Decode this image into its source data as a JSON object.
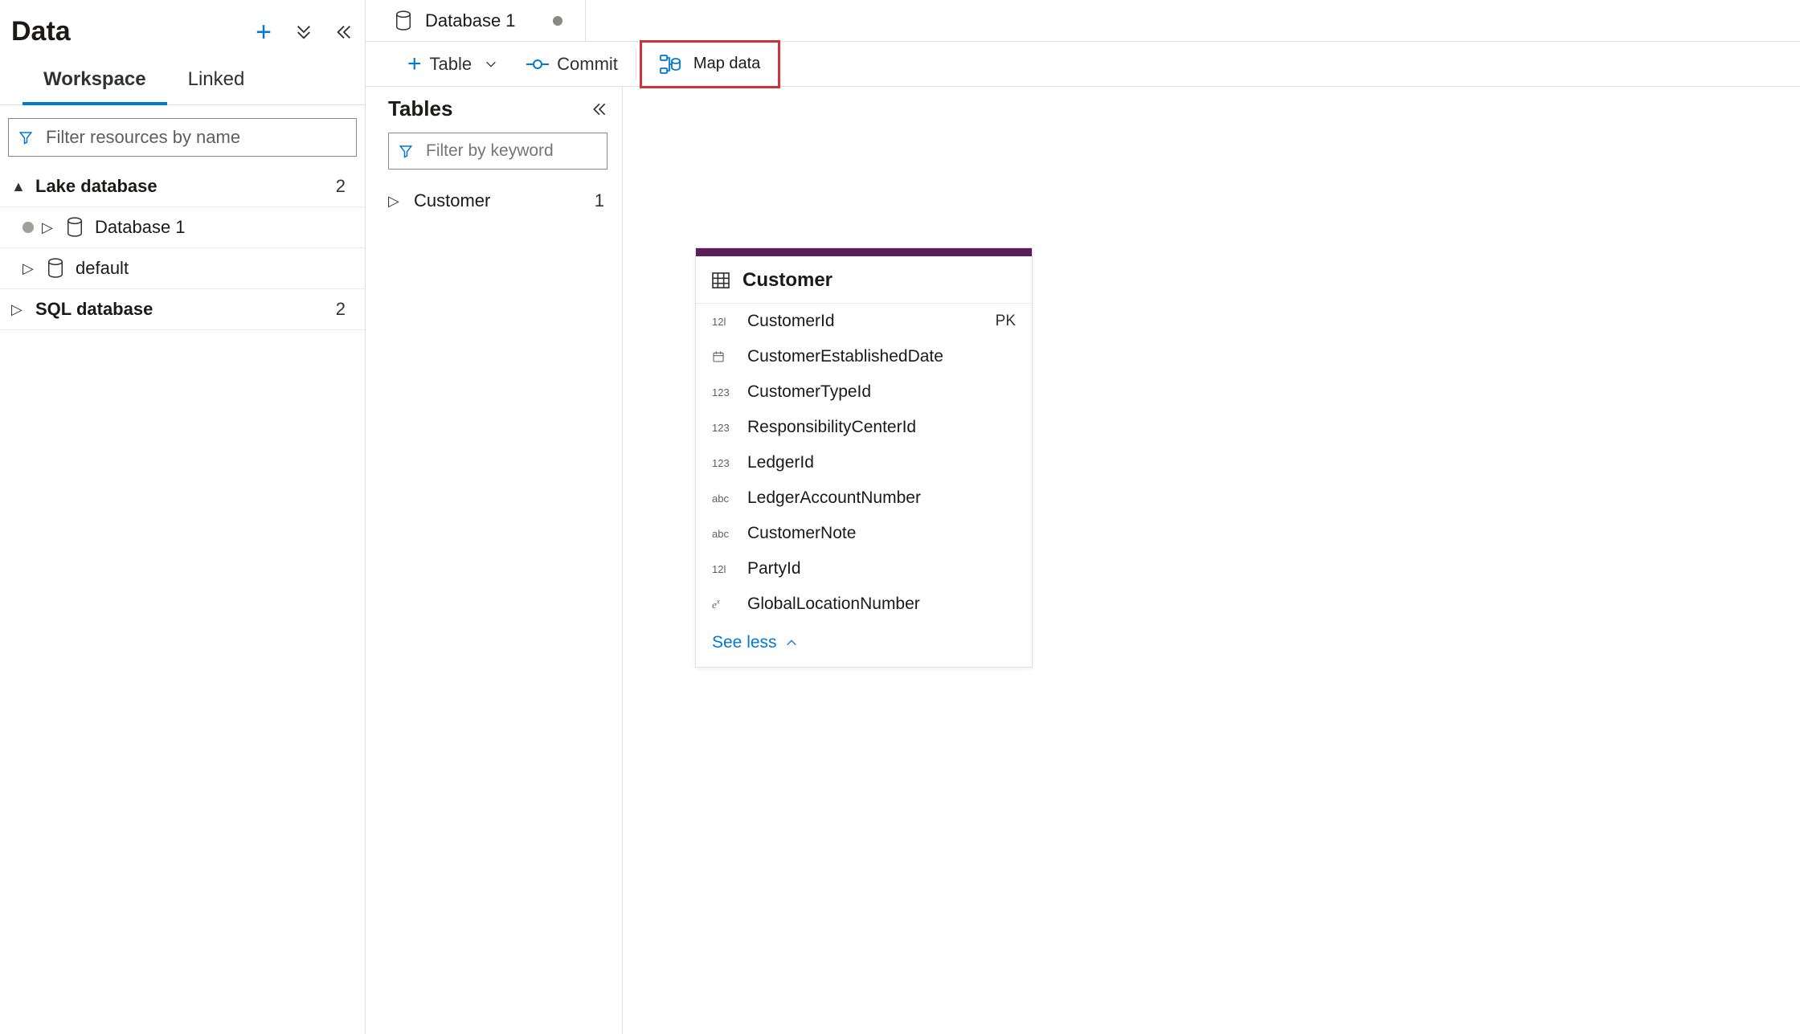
{
  "sidebar": {
    "title": "Data",
    "tabs": {
      "workspace": "Workspace",
      "linked": "Linked"
    },
    "filter_placeholder": "Filter resources by name",
    "tree": {
      "lake": {
        "label": "Lake database",
        "count": "2"
      },
      "db1": {
        "label": "Database 1"
      },
      "default": {
        "label": "default"
      },
      "sql": {
        "label": "SQL database",
        "count": "2"
      }
    }
  },
  "editor": {
    "tab_label": "Database 1",
    "toolbar": {
      "table": "Table",
      "commit": "Commit",
      "map_data": "Map data"
    }
  },
  "tables_pane": {
    "title": "Tables",
    "filter_placeholder": "Filter by keyword",
    "items": {
      "customer": {
        "label": "Customer",
        "count": "1"
      }
    }
  },
  "schema": {
    "title": "Customer",
    "columns": [
      {
        "type": "12l",
        "name": "CustomerId",
        "pk": "PK"
      },
      {
        "type": "cal",
        "name": "CustomerEstablishedDate",
        "pk": ""
      },
      {
        "type": "123",
        "name": "CustomerTypeId",
        "pk": ""
      },
      {
        "type": "123",
        "name": "ResponsibilityCenterId",
        "pk": ""
      },
      {
        "type": "123",
        "name": "LedgerId",
        "pk": ""
      },
      {
        "type": "abc",
        "name": "LedgerAccountNumber",
        "pk": ""
      },
      {
        "type": "abc",
        "name": "CustomerNote",
        "pk": ""
      },
      {
        "type": "12l",
        "name": "PartyId",
        "pk": ""
      },
      {
        "type": "ex",
        "name": "GlobalLocationNumber",
        "pk": ""
      }
    ],
    "see_less": "See less"
  }
}
